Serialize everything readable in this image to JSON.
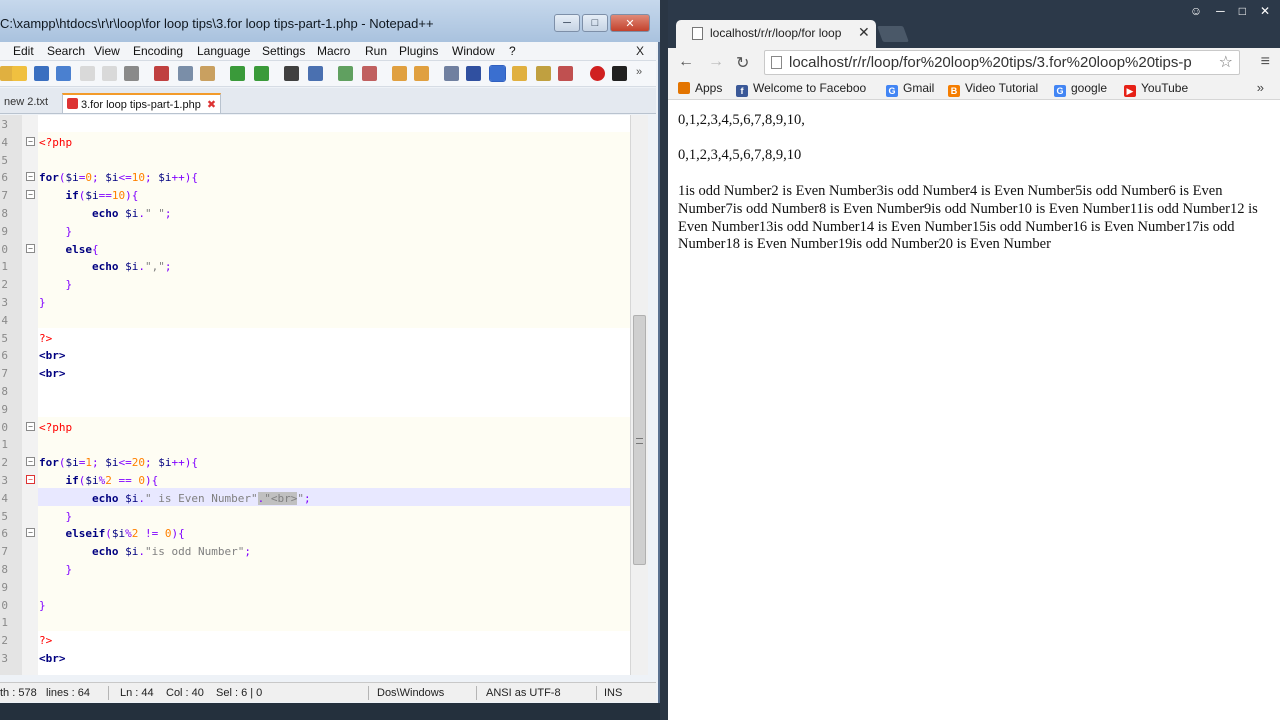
{
  "notepad": {
    "title": "C:\\xampp\\htdocs\\r\\r\\loop\\for loop tips\\3.for loop tips-part-1.php - Notepad++",
    "win_minimize": "─",
    "win_maximize": "□",
    "win_close": "✕",
    "menu": [
      "Edit",
      "Search",
      "View",
      "Encoding",
      "Language",
      "Settings",
      "Macro",
      "Run",
      "Plugins",
      "Window",
      "?"
    ],
    "menu_close": "X",
    "tabs": [
      {
        "label": "new  2.txt",
        "active": false
      },
      {
        "label": "3.for loop tips-part-1.php",
        "active": true
      }
    ],
    "tab_close": "✖",
    "line_numbers": [
      "3",
      "4",
      "5",
      "6",
      "7",
      "8",
      "9",
      "0",
      "1",
      "2",
      "3",
      "4",
      "5",
      "6",
      "7",
      "8",
      "9",
      "0",
      "1",
      "2",
      "3",
      "4",
      "5",
      "6",
      "7",
      "8",
      "9",
      "0",
      "1",
      "2",
      "3"
    ],
    "status": {
      "length": "th : 578",
      "lines": "lines : 64",
      "ln": "Ln : 44",
      "col": "Col : 40",
      "sel": "Sel : 6 | 0",
      "eol": "Dos\\Windows",
      "encoding": "ANSI as UTF-8",
      "mode": "INS"
    }
  },
  "chrome": {
    "tab_title": "localhost/r/r/loop/for loop",
    "tab_close": "✕",
    "window_controls": [
      "☺",
      "─",
      "□",
      "✕"
    ],
    "back": "←",
    "forward": "→",
    "reload": "↻",
    "url": "localhost/r/r/loop/for%20loop%20tips/3.for%20loop%20tips-p",
    "star": "☆",
    "menu": "≡",
    "bookmarks": [
      {
        "label": "Apps",
        "icon": "apps-grid-icon",
        "color": "#e37400"
      },
      {
        "label": "Welcome to Faceboo",
        "icon": "facebook-icon",
        "color": "#3b5998"
      },
      {
        "label": "Gmail",
        "icon": "google-g-icon",
        "color": "#4285f4"
      },
      {
        "label": "Video Tutorial",
        "icon": "blogger-icon",
        "color": "#f57d00"
      },
      {
        "label": "google",
        "icon": "google-g-icon",
        "color": "#4285f4"
      },
      {
        "label": "YouTube",
        "icon": "youtube-icon",
        "color": "#e62117"
      }
    ],
    "bookmarks_more": "»",
    "output": [
      "0,1,2,3,4,5,6,7,8,9,10,",
      "0,1,2,3,4,5,6,7,8,9,10",
      "1is odd Number2 is Even Number3is odd Number4 is Even Number5is odd Number6 is Even Number7is odd Number8 is Even Number9is odd Number10 is Even Number11is odd Number12 is Even Number13is odd Number14 is Even Number15is odd Number16 is Even Number17is odd Number18 is Even Number19is odd Number20 is Even Number"
    ]
  },
  "colors": {
    "php_keyword": "#000080",
    "php_number": "#ff8000",
    "php_string": "#808080",
    "php_tag": "#ff0000",
    "current_line": "#e8e8ff"
  }
}
